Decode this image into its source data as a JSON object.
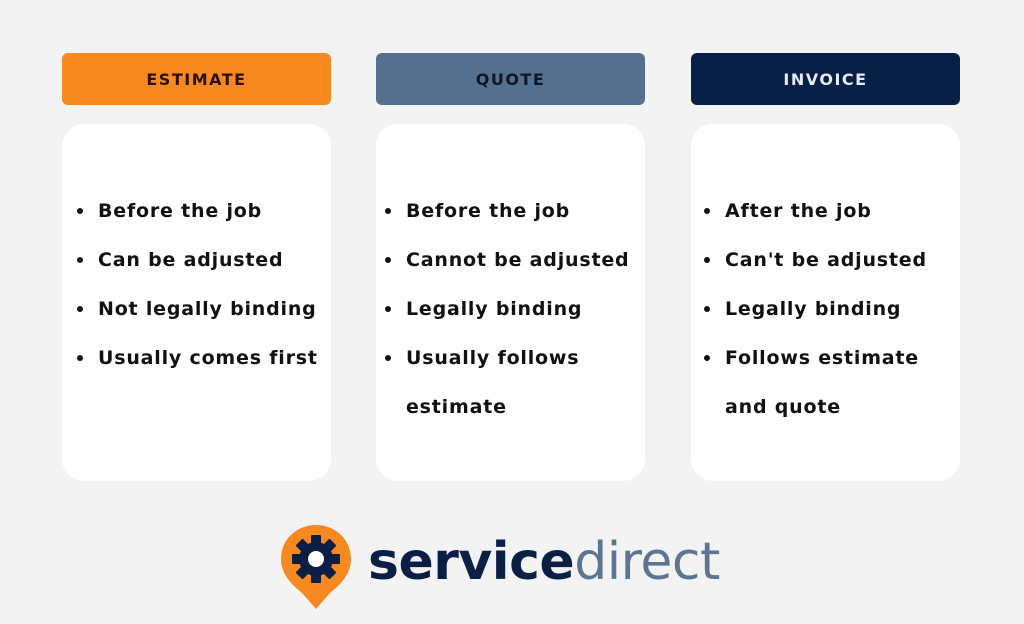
{
  "columns": [
    {
      "key": "estimate",
      "title": "ESTIMATE",
      "color": "#f68a21",
      "items": [
        {
          "lines": [
            "Before the job"
          ]
        },
        {
          "lines": [
            "Can be adjusted"
          ]
        },
        {
          "lines": [
            "Not legally binding"
          ]
        },
        {
          "lines": [
            "Usually comes first"
          ]
        }
      ]
    },
    {
      "key": "quote",
      "title": "QUOTE",
      "color": "#55708f",
      "items": [
        {
          "lines": [
            "Before the job"
          ]
        },
        {
          "lines": [
            "Cannot be adjusted"
          ]
        },
        {
          "lines": [
            "Legally binding"
          ]
        },
        {
          "lines": [
            "Usually follows",
            "estimate"
          ]
        }
      ]
    },
    {
      "key": "invoice",
      "title": "INVOICE",
      "color": "#061f45",
      "items": [
        {
          "lines": [
            "After the job"
          ]
        },
        {
          "lines": [
            "Can't be adjusted"
          ]
        },
        {
          "lines": [
            "Legally binding"
          ]
        },
        {
          "lines": [
            "Follows estimate",
            "and quote"
          ]
        }
      ]
    }
  ],
  "logo": {
    "icon": "gear-map-pin-icon",
    "text_bold": "service",
    "text_light": "direct",
    "pin_color": "#f68a21",
    "gear_color": "#0b1f45"
  }
}
